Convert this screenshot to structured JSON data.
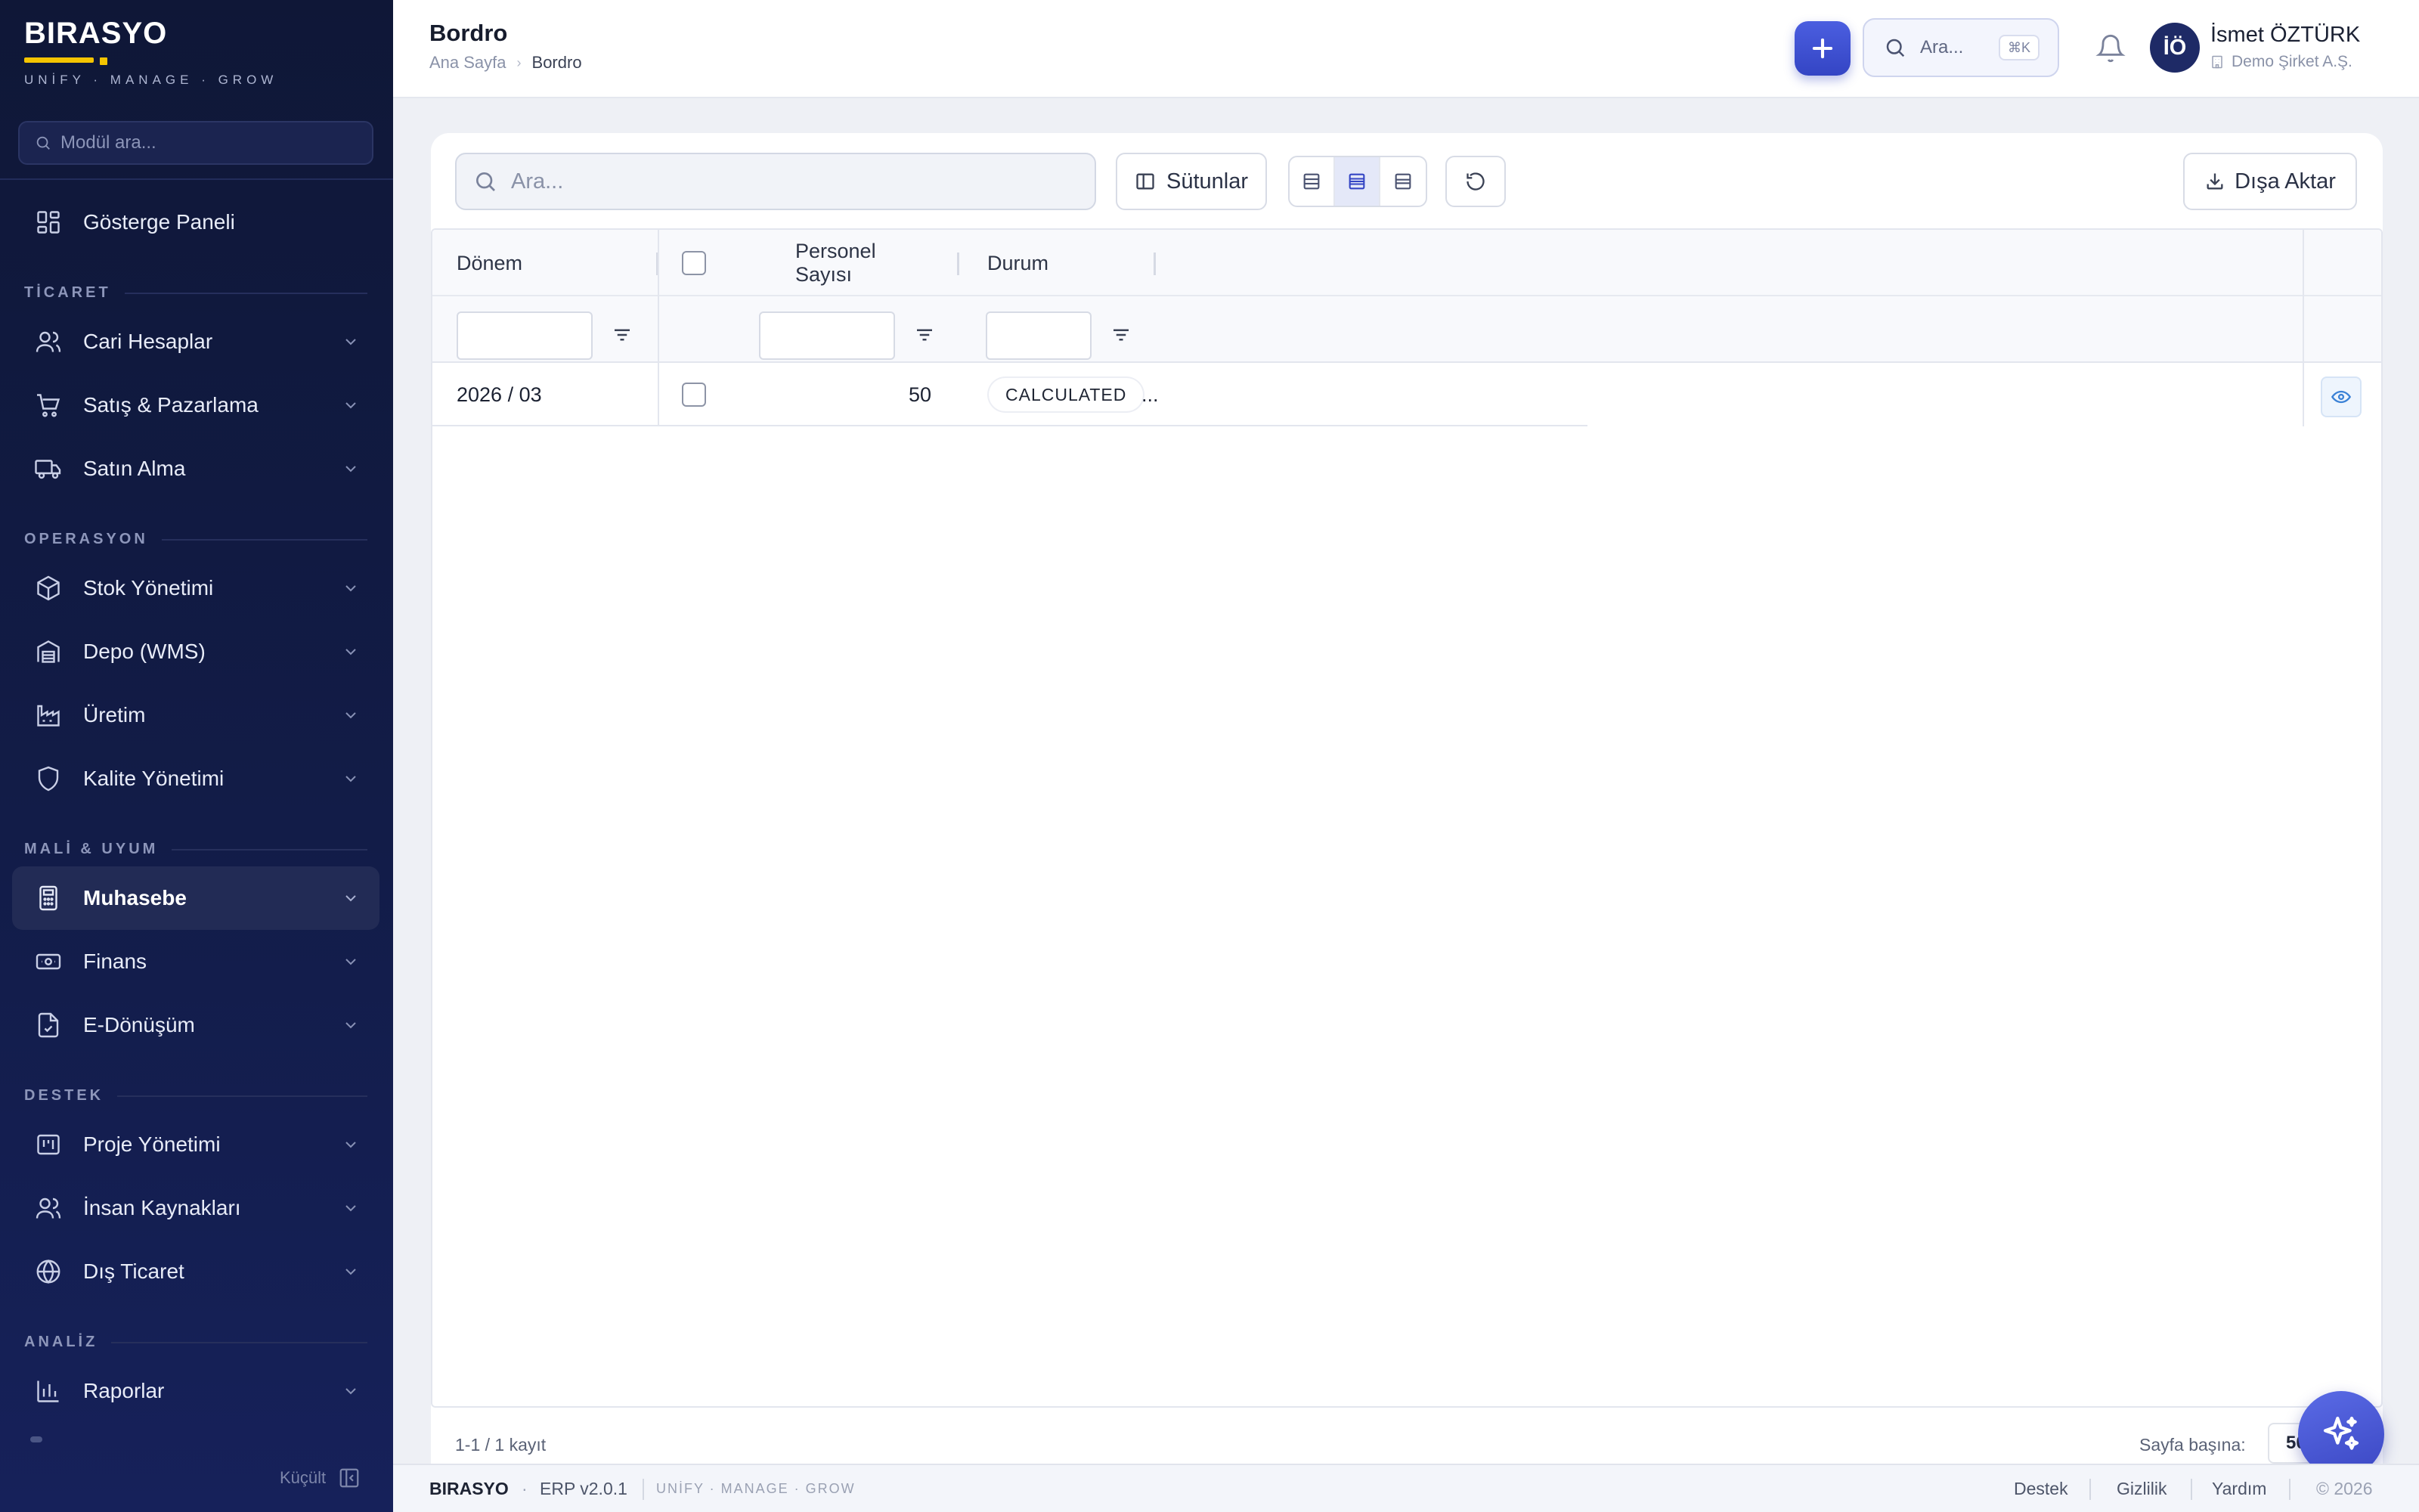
{
  "sidebar": {
    "brand": "BIRASYO",
    "tagline": "UNİFY · MANAGE · GROW",
    "search_placeholder": "Modül ara...",
    "collapse_label": "Küçült",
    "items": {
      "dashboard": "Gösterge Paneli",
      "cari": "Cari Hesaplar",
      "satis": "Satış & Pazarlama",
      "satinalma": "Satın Alma",
      "stok": "Stok Yönetimi",
      "depo": "Depo (WMS)",
      "uretim": "Üretim",
      "kalite": "Kalite Yönetimi",
      "muhasebe": "Muhasebe",
      "finans": "Finans",
      "edonusum": "E-Dönüşüm",
      "proje": "Proje Yönetimi",
      "ik": "İnsan Kaynakları",
      "dis": "Dış Ticaret",
      "raporlar": "Raporlar"
    },
    "sections": {
      "ticaret": "TİCARET",
      "operasyon": "OPERASYON",
      "mali": "MALİ & UYUM",
      "destek": "DESTEK",
      "analiz": "ANALİZ"
    },
    "active_item": "Muhasebe"
  },
  "header": {
    "title": "Bordro",
    "breadcrumb": {
      "home": "Ana Sayfa",
      "current": "Bordro"
    },
    "search_placeholder": "Ara...",
    "shortcut": "⌘K",
    "user": {
      "initials": "İÖ",
      "name": "İsmet ÖZTÜRK",
      "company": "Demo Şirket A.Ş."
    }
  },
  "toolbar": {
    "search_placeholder": "Ara...",
    "columns_label": "Sütunlar",
    "export_label": "Dışa Aktar",
    "density_selected": "standard"
  },
  "table": {
    "columns": {
      "donem": "Dönem",
      "personel": "Personel Sayısı",
      "durum": "Durum"
    },
    "rows": [
      {
        "donem": "2026 / 03",
        "personel": "50",
        "durum": "CALCULATED",
        "more": "..."
      }
    ]
  },
  "pagination": {
    "record_count": "1-1 / 1 kayıt",
    "per_page_label": "Sayfa başına:",
    "per_page_value": "50"
  },
  "footer": {
    "brand": "BIRASYO",
    "separator": "·",
    "version": "ERP v2.0.1",
    "tagline": "UNİFY · MANAGE · GROW",
    "links": {
      "destek": "Destek",
      "gizlilik": "Gizlilik",
      "yardim": "Yardım"
    },
    "copyright": "© 2026"
  },
  "colors": {
    "sidebar_bg": "#0f1737",
    "accent": "#3445c4",
    "brand_yellow": "#f4c400"
  }
}
